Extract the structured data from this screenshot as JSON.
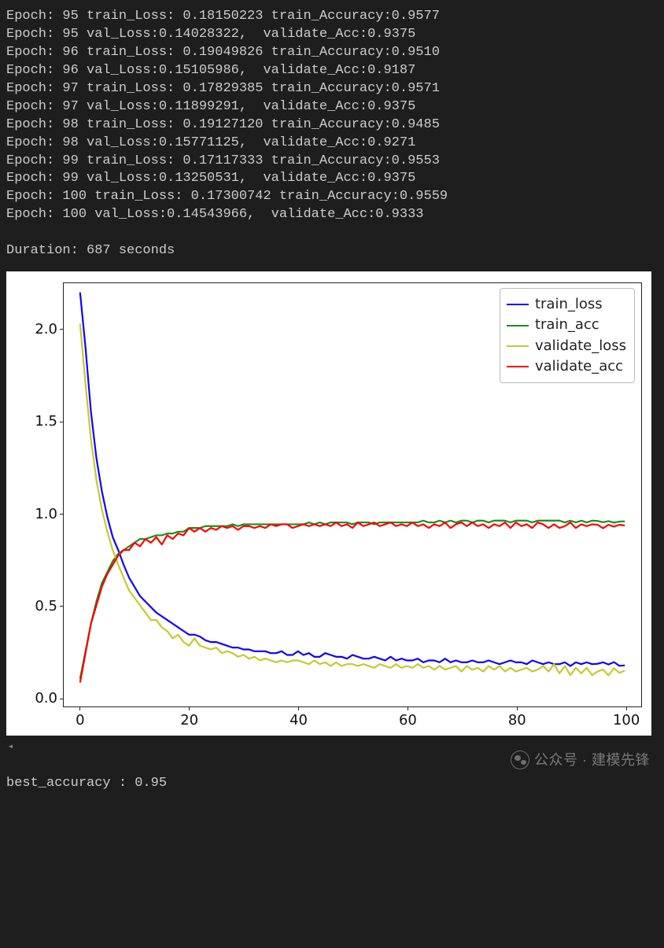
{
  "log_lines": [
    "Epoch: 95 train_Loss: 0.18150223 train_Accuracy:0.9577",
    "Epoch: 95 val_Loss:0.14028322,  validate_Acc:0.9375",
    "Epoch: 96 train_Loss: 0.19049826 train_Accuracy:0.9510",
    "Epoch: 96 val_Loss:0.15105986,  validate_Acc:0.9187",
    "Epoch: 97 train_Loss: 0.17829385 train_Accuracy:0.9571",
    "Epoch: 97 val_Loss:0.11899291,  validate_Acc:0.9375",
    "Epoch: 98 train_Loss: 0.19127120 train_Accuracy:0.9485",
    "Epoch: 98 val_Loss:0.15771125,  validate_Acc:0.9271",
    "Epoch: 99 train_Loss: 0.17117333 train_Accuracy:0.9553",
    "Epoch: 99 val_Loss:0.13250531,  validate_Acc:0.9375",
    "Epoch: 100 train_Loss: 0.17300742 train_Accuracy:0.9559",
    "Epoch: 100 val_Loss:0.14543966,  validate_Acc:0.9333"
  ],
  "duration_line": "Duration: 687 seconds",
  "best_line": "best_accuracy : 0.95",
  "wechat_text": "公众号 · 建模先锋",
  "chart_data": {
    "type": "line",
    "xlabel": "",
    "ylabel": "",
    "xlim": [
      -3,
      103
    ],
    "ylim": [
      -0.05,
      2.25
    ],
    "xticks": [
      0,
      20,
      40,
      60,
      80,
      100
    ],
    "yticks": [
      0.0,
      0.5,
      1.0,
      1.5,
      2.0
    ],
    "xtick_labels": [
      "0",
      "20",
      "40",
      "60",
      "80",
      "100"
    ],
    "ytick_labels": [
      "0.0",
      "0.5",
      "1.0",
      "1.5",
      "2.0"
    ],
    "legend": {
      "position": "upper right",
      "entries": [
        {
          "name": "train_loss",
          "color": "#1100ff"
        },
        {
          "name": "train_acc",
          "color": "#1d8d1d"
        },
        {
          "name": "validate_loss",
          "color": "#c7c92c"
        },
        {
          "name": "validate_acc",
          "color": "#ff0000"
        }
      ]
    },
    "x": [
      0,
      1,
      2,
      3,
      4,
      5,
      6,
      7,
      8,
      9,
      10,
      11,
      12,
      13,
      14,
      15,
      16,
      17,
      18,
      19,
      20,
      21,
      22,
      23,
      24,
      25,
      26,
      27,
      28,
      29,
      30,
      31,
      32,
      33,
      34,
      35,
      36,
      37,
      38,
      39,
      40,
      41,
      42,
      43,
      44,
      45,
      46,
      47,
      48,
      49,
      50,
      51,
      52,
      53,
      54,
      55,
      56,
      57,
      58,
      59,
      60,
      61,
      62,
      63,
      64,
      65,
      66,
      67,
      68,
      69,
      70,
      71,
      72,
      73,
      74,
      75,
      76,
      77,
      78,
      79,
      80,
      81,
      82,
      83,
      84,
      85,
      86,
      87,
      88,
      89,
      90,
      91,
      92,
      93,
      94,
      95,
      96,
      97,
      98,
      99,
      100
    ],
    "series": [
      {
        "name": "train_loss",
        "color": "#1100ff",
        "values": [
          2.2,
          1.9,
          1.55,
          1.3,
          1.12,
          0.98,
          0.87,
          0.8,
          0.72,
          0.65,
          0.6,
          0.55,
          0.52,
          0.49,
          0.46,
          0.44,
          0.42,
          0.4,
          0.38,
          0.36,
          0.34,
          0.34,
          0.33,
          0.31,
          0.3,
          0.3,
          0.29,
          0.28,
          0.27,
          0.27,
          0.26,
          0.26,
          0.25,
          0.25,
          0.25,
          0.24,
          0.24,
          0.25,
          0.23,
          0.23,
          0.25,
          0.23,
          0.24,
          0.22,
          0.22,
          0.24,
          0.23,
          0.22,
          0.22,
          0.21,
          0.23,
          0.22,
          0.21,
          0.21,
          0.22,
          0.21,
          0.2,
          0.22,
          0.2,
          0.21,
          0.2,
          0.2,
          0.21,
          0.19,
          0.2,
          0.2,
          0.19,
          0.21,
          0.19,
          0.2,
          0.19,
          0.19,
          0.2,
          0.19,
          0.19,
          0.2,
          0.19,
          0.18,
          0.19,
          0.2,
          0.19,
          0.19,
          0.18,
          0.2,
          0.19,
          0.18,
          0.19,
          0.18,
          0.18,
          0.19,
          0.17,
          0.19,
          0.18,
          0.19,
          0.18,
          0.182,
          0.19,
          0.178,
          0.191,
          0.171,
          0.173
        ]
      },
      {
        "name": "train_acc",
        "color": "#1d8d1d",
        "values": [
          0.1,
          0.25,
          0.4,
          0.52,
          0.62,
          0.68,
          0.74,
          0.78,
          0.8,
          0.82,
          0.84,
          0.86,
          0.86,
          0.87,
          0.88,
          0.88,
          0.89,
          0.89,
          0.9,
          0.9,
          0.92,
          0.92,
          0.92,
          0.93,
          0.93,
          0.93,
          0.93,
          0.93,
          0.94,
          0.93,
          0.94,
          0.94,
          0.94,
          0.94,
          0.94,
          0.94,
          0.94,
          0.94,
          0.94,
          0.94,
          0.94,
          0.94,
          0.95,
          0.94,
          0.95,
          0.94,
          0.95,
          0.95,
          0.95,
          0.95,
          0.94,
          0.95,
          0.95,
          0.95,
          0.94,
          0.95,
          0.95,
          0.95,
          0.95,
          0.95,
          0.95,
          0.95,
          0.95,
          0.96,
          0.95,
          0.95,
          0.96,
          0.95,
          0.96,
          0.95,
          0.96,
          0.96,
          0.95,
          0.96,
          0.96,
          0.95,
          0.96,
          0.96,
          0.96,
          0.95,
          0.96,
          0.96,
          0.96,
          0.95,
          0.96,
          0.96,
          0.96,
          0.96,
          0.96,
          0.95,
          0.96,
          0.95,
          0.96,
          0.95,
          0.96,
          0.958,
          0.951,
          0.957,
          0.949,
          0.955,
          0.956
        ]
      },
      {
        "name": "validate_loss",
        "color": "#c7c92c",
        "values": [
          2.03,
          1.7,
          1.4,
          1.18,
          1.02,
          0.9,
          0.8,
          0.72,
          0.65,
          0.58,
          0.54,
          0.5,
          0.46,
          0.42,
          0.42,
          0.38,
          0.36,
          0.32,
          0.34,
          0.3,
          0.28,
          0.32,
          0.28,
          0.27,
          0.26,
          0.27,
          0.24,
          0.25,
          0.24,
          0.22,
          0.23,
          0.21,
          0.22,
          0.2,
          0.21,
          0.2,
          0.19,
          0.2,
          0.19,
          0.2,
          0.2,
          0.19,
          0.18,
          0.2,
          0.18,
          0.19,
          0.17,
          0.19,
          0.17,
          0.18,
          0.18,
          0.17,
          0.18,
          0.17,
          0.16,
          0.18,
          0.17,
          0.16,
          0.18,
          0.16,
          0.17,
          0.16,
          0.18,
          0.16,
          0.17,
          0.15,
          0.17,
          0.15,
          0.16,
          0.17,
          0.14,
          0.17,
          0.15,
          0.16,
          0.14,
          0.17,
          0.15,
          0.17,
          0.14,
          0.16,
          0.14,
          0.15,
          0.16,
          0.14,
          0.15,
          0.17,
          0.14,
          0.18,
          0.13,
          0.17,
          0.12,
          0.16,
          0.13,
          0.16,
          0.12,
          0.14,
          0.151,
          0.119,
          0.158,
          0.133,
          0.145
        ]
      },
      {
        "name": "validate_acc",
        "color": "#ff0000",
        "values": [
          0.08,
          0.24,
          0.4,
          0.5,
          0.6,
          0.67,
          0.72,
          0.77,
          0.8,
          0.8,
          0.84,
          0.82,
          0.86,
          0.84,
          0.87,
          0.83,
          0.88,
          0.86,
          0.89,
          0.88,
          0.92,
          0.9,
          0.92,
          0.9,
          0.92,
          0.91,
          0.93,
          0.92,
          0.93,
          0.91,
          0.93,
          0.93,
          0.92,
          0.93,
          0.92,
          0.94,
          0.93,
          0.94,
          0.94,
          0.92,
          0.93,
          0.94,
          0.93,
          0.94,
          0.93,
          0.94,
          0.93,
          0.95,
          0.93,
          0.94,
          0.92,
          0.95,
          0.93,
          0.94,
          0.95,
          0.93,
          0.94,
          0.95,
          0.93,
          0.94,
          0.93,
          0.95,
          0.93,
          0.94,
          0.92,
          0.94,
          0.93,
          0.95,
          0.92,
          0.94,
          0.95,
          0.93,
          0.95,
          0.93,
          0.94,
          0.92,
          0.94,
          0.93,
          0.95,
          0.92,
          0.95,
          0.93,
          0.94,
          0.92,
          0.95,
          0.94,
          0.92,
          0.94,
          0.92,
          0.93,
          0.95,
          0.92,
          0.94,
          0.93,
          0.94,
          0.9375,
          0.9187,
          0.9375,
          0.9271,
          0.9375,
          0.9333
        ]
      }
    ]
  }
}
